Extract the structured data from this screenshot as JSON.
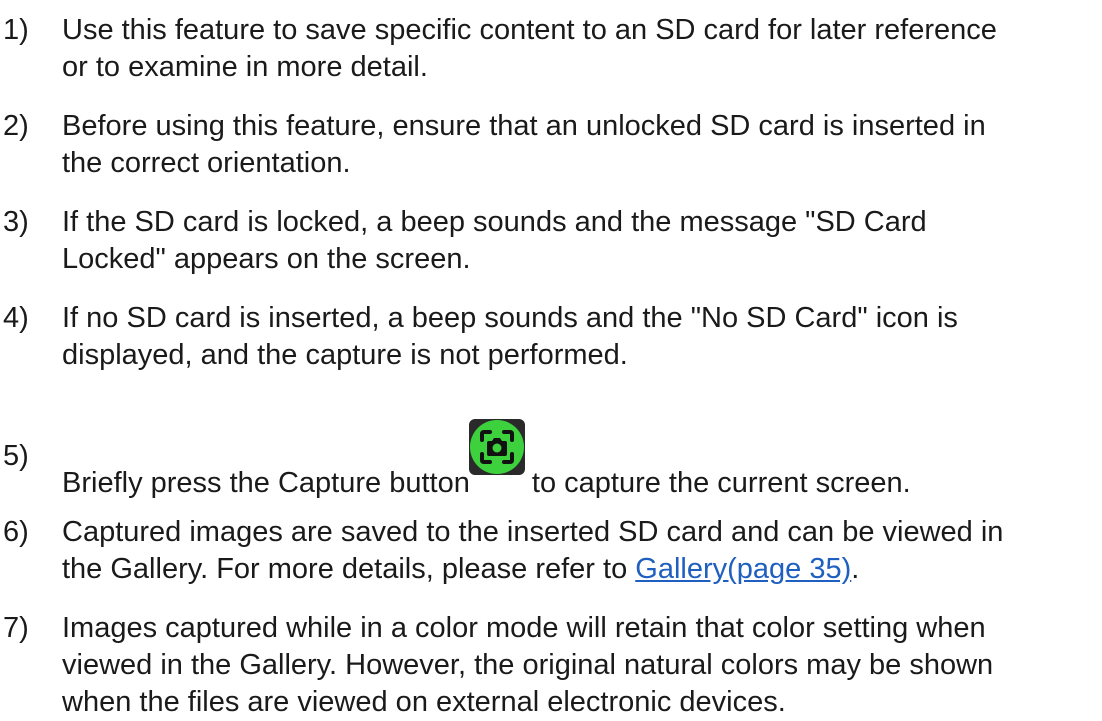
{
  "items": [
    {
      "number": "1)",
      "lines": [
        "Use this feature to save specific content to an SD card for later reference",
        "or to examine in more detail."
      ]
    },
    {
      "number": "2)",
      "lines": [
        "Before using this feature, ensure that an unlocked SD card is inserted in",
        "the correct orientation."
      ]
    },
    {
      "number": "3)",
      "lines": [
        "If the SD card is locked, a beep sounds and the message \"SD Card",
        "Locked\" appears on the screen."
      ]
    },
    {
      "number": "4)",
      "lines": [
        "If no SD card is inserted, a beep sounds and the \"No SD Card\" icon is",
        "displayed, and the capture is not performed."
      ]
    },
    {
      "number": "5)",
      "before_icon": "Briefly press the Capture button",
      "after_icon": " to capture the current screen.",
      "icon": "camera-capture-icon",
      "icon_color": "#3dd13d"
    },
    {
      "number": "6)",
      "lines": [
        "Captured images are saved to the inserted SD card and can be viewed in"
      ],
      "line2_before_link": "the Gallery. For more details, please refer to ",
      "link_text": "Gallery(page 35)",
      "line2_after_link": "."
    },
    {
      "number": "7)",
      "lines": [
        "Images captured while in a color mode will retain that color setting when",
        "viewed in the Gallery. However, the original natural colors may be shown",
        "when the files are viewed on external electronic devices."
      ]
    }
  ],
  "colors": {
    "link": "#1f5fbf",
    "text": "#1a1a1a"
  }
}
